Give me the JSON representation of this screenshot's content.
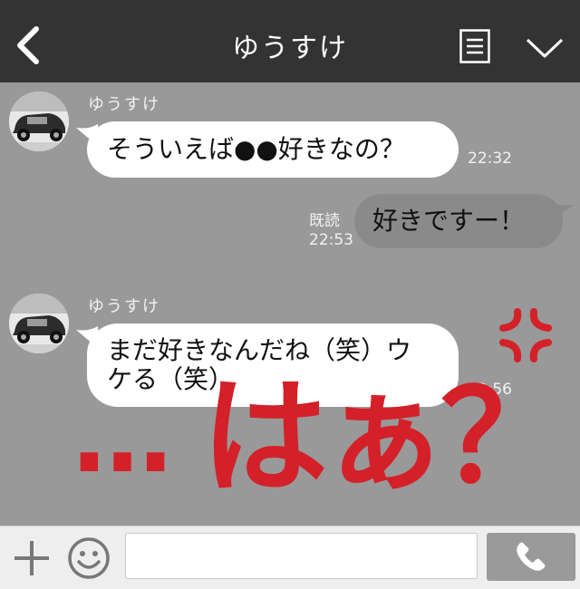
{
  "header": {
    "title": "ゆうすけ",
    "icons": {
      "back": "chevron-left-icon",
      "menu": "list-icon",
      "collapse": "chevron-down-icon"
    },
    "background": "#333333"
  },
  "messages": [
    {
      "sender": "ゆうすけ",
      "text": "そういえば●●好きなの？",
      "time": "22:32"
    },
    {
      "sender": "me",
      "text": "好きですー！",
      "read": "既読",
      "time": "22:53"
    },
    {
      "sender": "ゆうすけ",
      "text_line1": "まだ好きなんだね（笑）ウ",
      "text_line2": "ケる（笑）",
      "time": "22:56"
    }
  ],
  "overlay": {
    "dots": "…",
    "text": "はぁ？",
    "color": "#d42028",
    "anger_icon": "anger-mark-icon"
  },
  "footer": {
    "input_value": "",
    "icons": {
      "add": "plus-icon",
      "emoji": "smiley-icon",
      "call": "phone-icon"
    }
  }
}
